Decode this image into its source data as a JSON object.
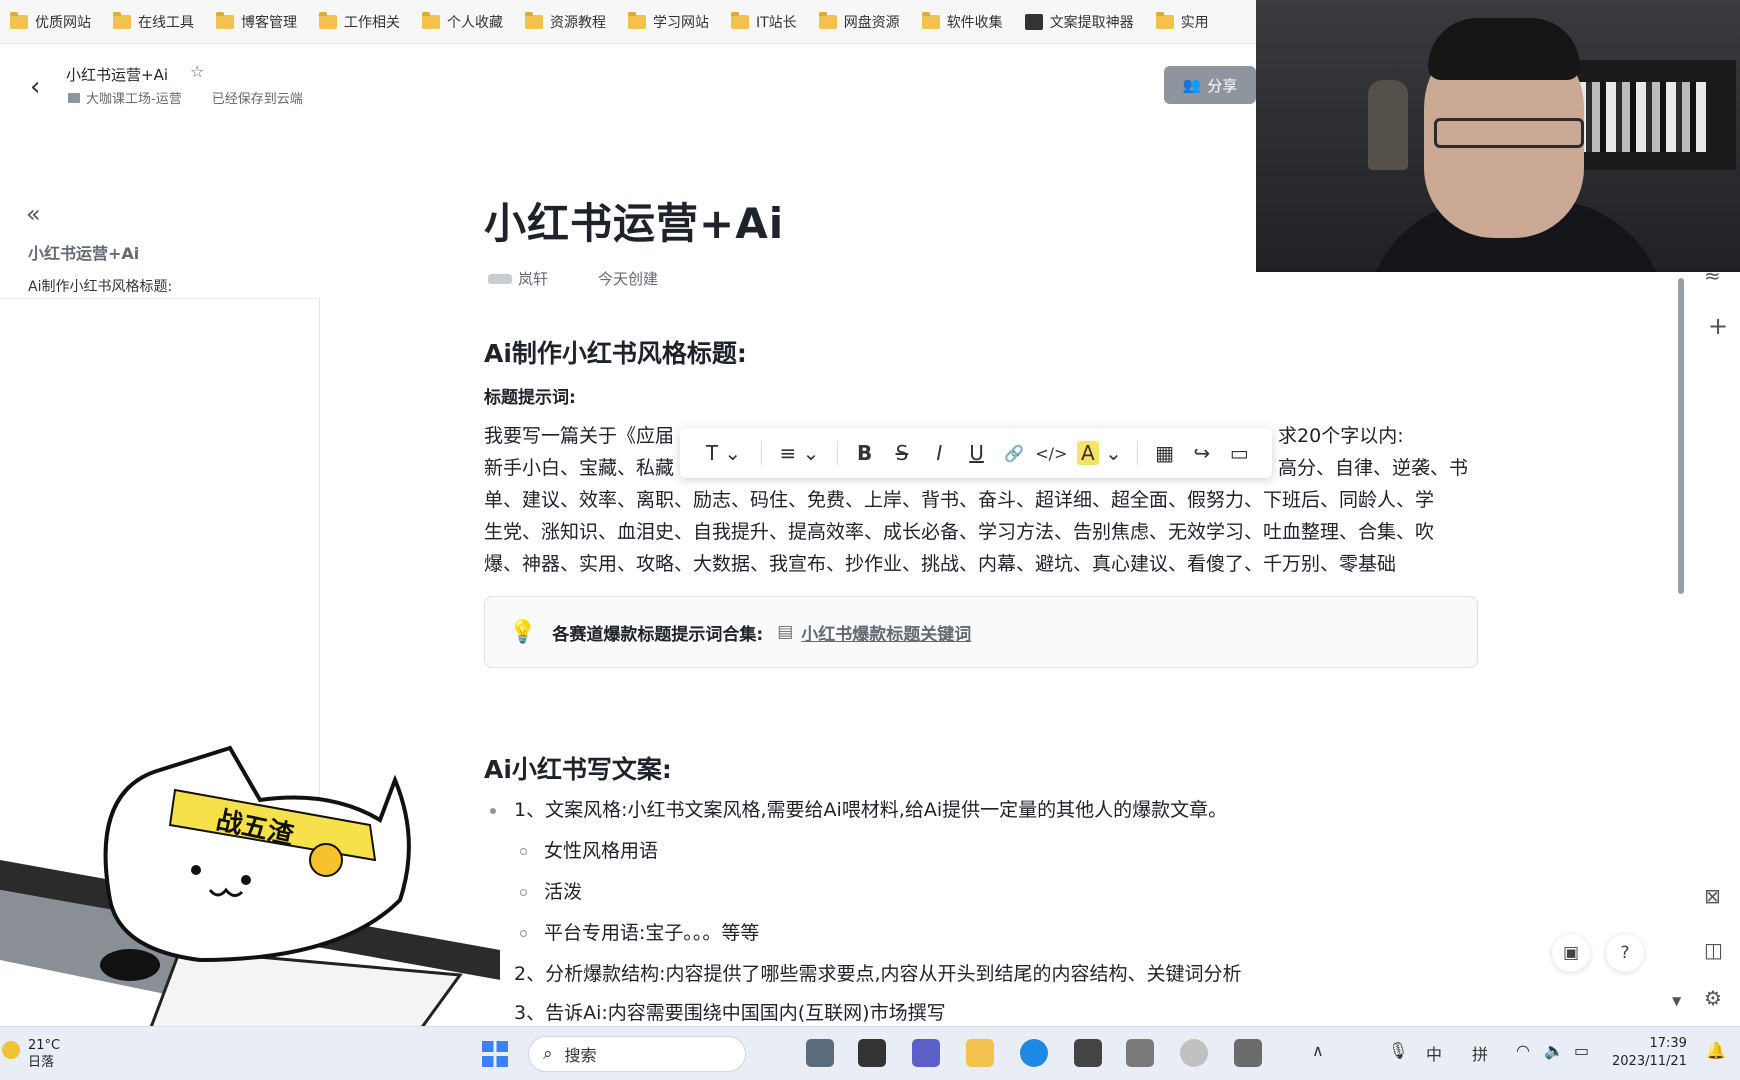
{
  "bookmarks": [
    "优质网站",
    "在线工具",
    "博客管理",
    "工作相关",
    "个人收藏",
    "资源教程",
    "学习网站",
    "IT站长",
    "网盘资源",
    "软件收集",
    "文案提取神器",
    "实用"
  ],
  "doc": {
    "title_small": "小红书运营+Ai",
    "breadcrumb": "大咖课工场-运营",
    "save_status": "已经保存到云端",
    "share_label": "分享"
  },
  "outline": {
    "title": "小红书运营+Ai",
    "items": [
      "Ai制作小红书风格标题:"
    ]
  },
  "main": {
    "title": "小红书运营+Ai",
    "author": "岚轩",
    "created": "今天创建",
    "section1_heading": "Ai制作小红书风格标题:",
    "prompt_label": "标题提示词:",
    "prompt_line1_a": "我要写一篇关于《应届",
    "prompt_line1_b": "求20个字以内:",
    "prompt_line2_a": "新手小白、宝藏、私藏",
    "prompt_line2_b": "高分、自律、逆袭、书",
    "prompt_line3": "单、建议、效率、离职、励志、码住、免费、上岸、背书、奋斗、超详细、超全面、假努力、下班后、同龄人、学",
    "prompt_line4": "生党、涨知识、血泪史、自我提升、提高效率、成长必备、学习方法、告别焦虑、无效学习、吐血整理、合集、吹",
    "prompt_line5": "爆、神器、实用、攻略、大数据、我宣布、抄作业、挑战、内幕、避坑、真心建议、看傻了、千万别、零基础",
    "callout_label": "各赛道爆款标题提示词合集:",
    "callout_link": "小红书爆款标题关键词",
    "section2_heading": "Ai小红书写文案:",
    "list": [
      "1、文案风格:小红书文案风格,需要给Ai喂材料,给Ai提供一定量的其他人的爆款文章。",
      "女性风格用语",
      "活泼",
      "平台专用语:宝子。。。等等",
      "2、分析爆款结构:内容提供了哪些需求要点,内容从开头到结尾的内容结构、关键词分析",
      "3、告诉Ai:内容需要围绕中国国内(互联网)市场撰写"
    ]
  },
  "toolbar": {
    "text_style": "T",
    "align": "≡",
    "bold": "B",
    "strike": "S",
    "italic": "I",
    "underline": "U",
    "link": "🔗",
    "code": "</>",
    "highlight": "A"
  },
  "sticker": {
    "headband_text": "战五渣"
  },
  "taskbar": {
    "temperature": "21°C",
    "weather": "日落",
    "search_placeholder": "搜索",
    "ime_lang": "中",
    "ime_mode": "拼",
    "time": "17:39",
    "date": "2023/11/21"
  },
  "colors": {
    "accent": "#3370ff",
    "share_button": "#8f959e",
    "highlight": "#f7e36a"
  }
}
